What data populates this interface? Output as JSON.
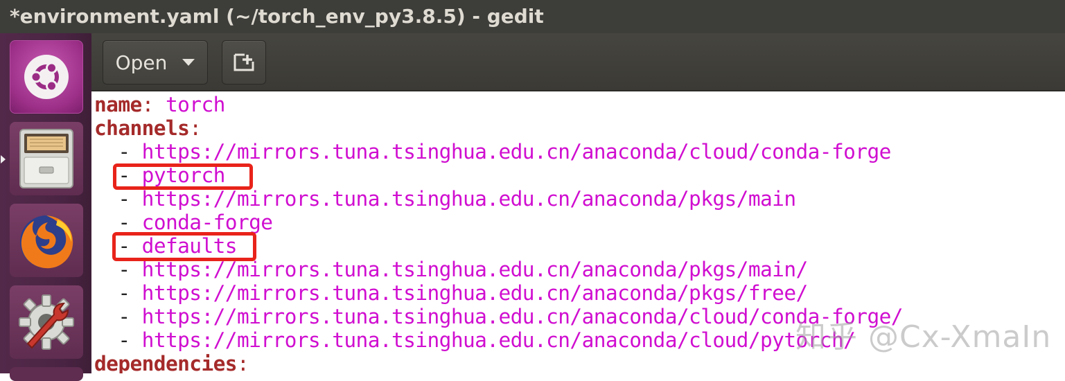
{
  "window": {
    "title": "*environment.yaml (~/torch_env_py3.8.5) - gedit"
  },
  "launcher": {
    "items": [
      {
        "name": "Ubuntu dash",
        "icon": "ubuntu-logo-icon"
      },
      {
        "name": "Files",
        "icon": "file-cabinet-icon"
      },
      {
        "name": "Firefox",
        "icon": "firefox-icon"
      },
      {
        "name": "System Settings",
        "icon": "settings-gear-wrench-icon"
      }
    ]
  },
  "toolbar": {
    "open_label": "Open",
    "open_dropdown_icon": "caret-down-icon",
    "new_document_icon": "new-document-plus-icon"
  },
  "editor": {
    "lines": [
      {
        "key": "name",
        "sep": ": ",
        "value": "torch"
      },
      {
        "key": "channels",
        "sep": ":",
        "value": ""
      },
      {
        "dash": "  - ",
        "value": "https://mirrors.tuna.tsinghua.edu.cn/anaconda/cloud/conda-forge"
      },
      {
        "dash": "  - ",
        "value": "pytorch"
      },
      {
        "dash": "  - ",
        "value": "https://mirrors.tuna.tsinghua.edu.cn/anaconda/pkgs/main"
      },
      {
        "dash": "  - ",
        "value": "conda-forge"
      },
      {
        "dash": "  - ",
        "value": "defaults"
      },
      {
        "dash": "  - ",
        "value": "https://mirrors.tuna.tsinghua.edu.cn/anaconda/pkgs/main/"
      },
      {
        "dash": "  - ",
        "value": "https://mirrors.tuna.tsinghua.edu.cn/anaconda/pkgs/free/"
      },
      {
        "dash": "  - ",
        "value": "https://mirrors.tuna.tsinghua.edu.cn/anaconda/cloud/conda-forge/"
      },
      {
        "dash": "  - ",
        "value": "https://mirrors.tuna.tsinghua.edu.cn/anaconda/cloud/pytorch/"
      },
      {
        "key": "dependencies",
        "sep": ":",
        "value": ""
      }
    ],
    "highlighted_entries": [
      "pytorch",
      "defaults"
    ]
  },
  "watermark": {
    "text": "知乎 @Cx-XmaIn"
  },
  "colors": {
    "titlebar_bg": "#3d3d3a",
    "launcher_bg": "#4a2443",
    "key_color": "#a52a2a",
    "value_color": "#d00ed0",
    "highlight_box": "#e8231a"
  }
}
